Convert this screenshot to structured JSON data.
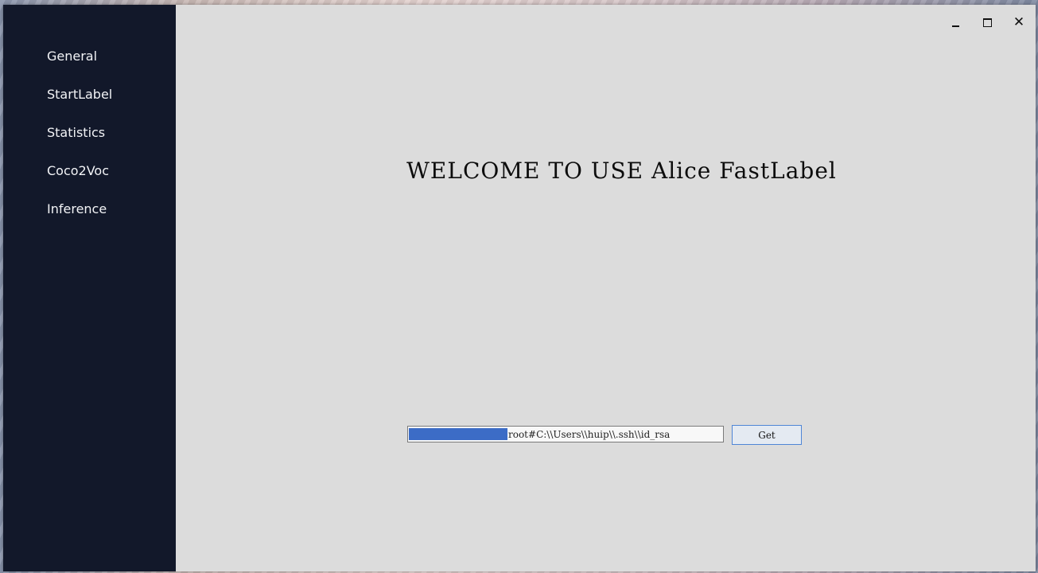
{
  "window": {
    "controls": {
      "minimize_icon": "minimize-icon",
      "maximize_icon": "maximize-icon",
      "close_icon": "close-icon",
      "close_glyph": "✕"
    }
  },
  "sidebar": {
    "items": [
      {
        "label": "General"
      },
      {
        "label": "StartLabel"
      },
      {
        "label": "Statistics"
      },
      {
        "label": "Coco2Voc"
      },
      {
        "label": "Inference"
      }
    ]
  },
  "main": {
    "welcome_text": "WELCOME TO USE Alice FastLabel",
    "path_input": {
      "value": "root#C:\\\\Users\\\\huip\\\\.ssh\\\\id_rsa"
    },
    "get_button_label": "Get"
  },
  "colors": {
    "sidebar_bg": "#12182a",
    "main_bg": "#dcdcdc",
    "selection": "#3c6cc6",
    "button_border": "#4f86d6"
  }
}
